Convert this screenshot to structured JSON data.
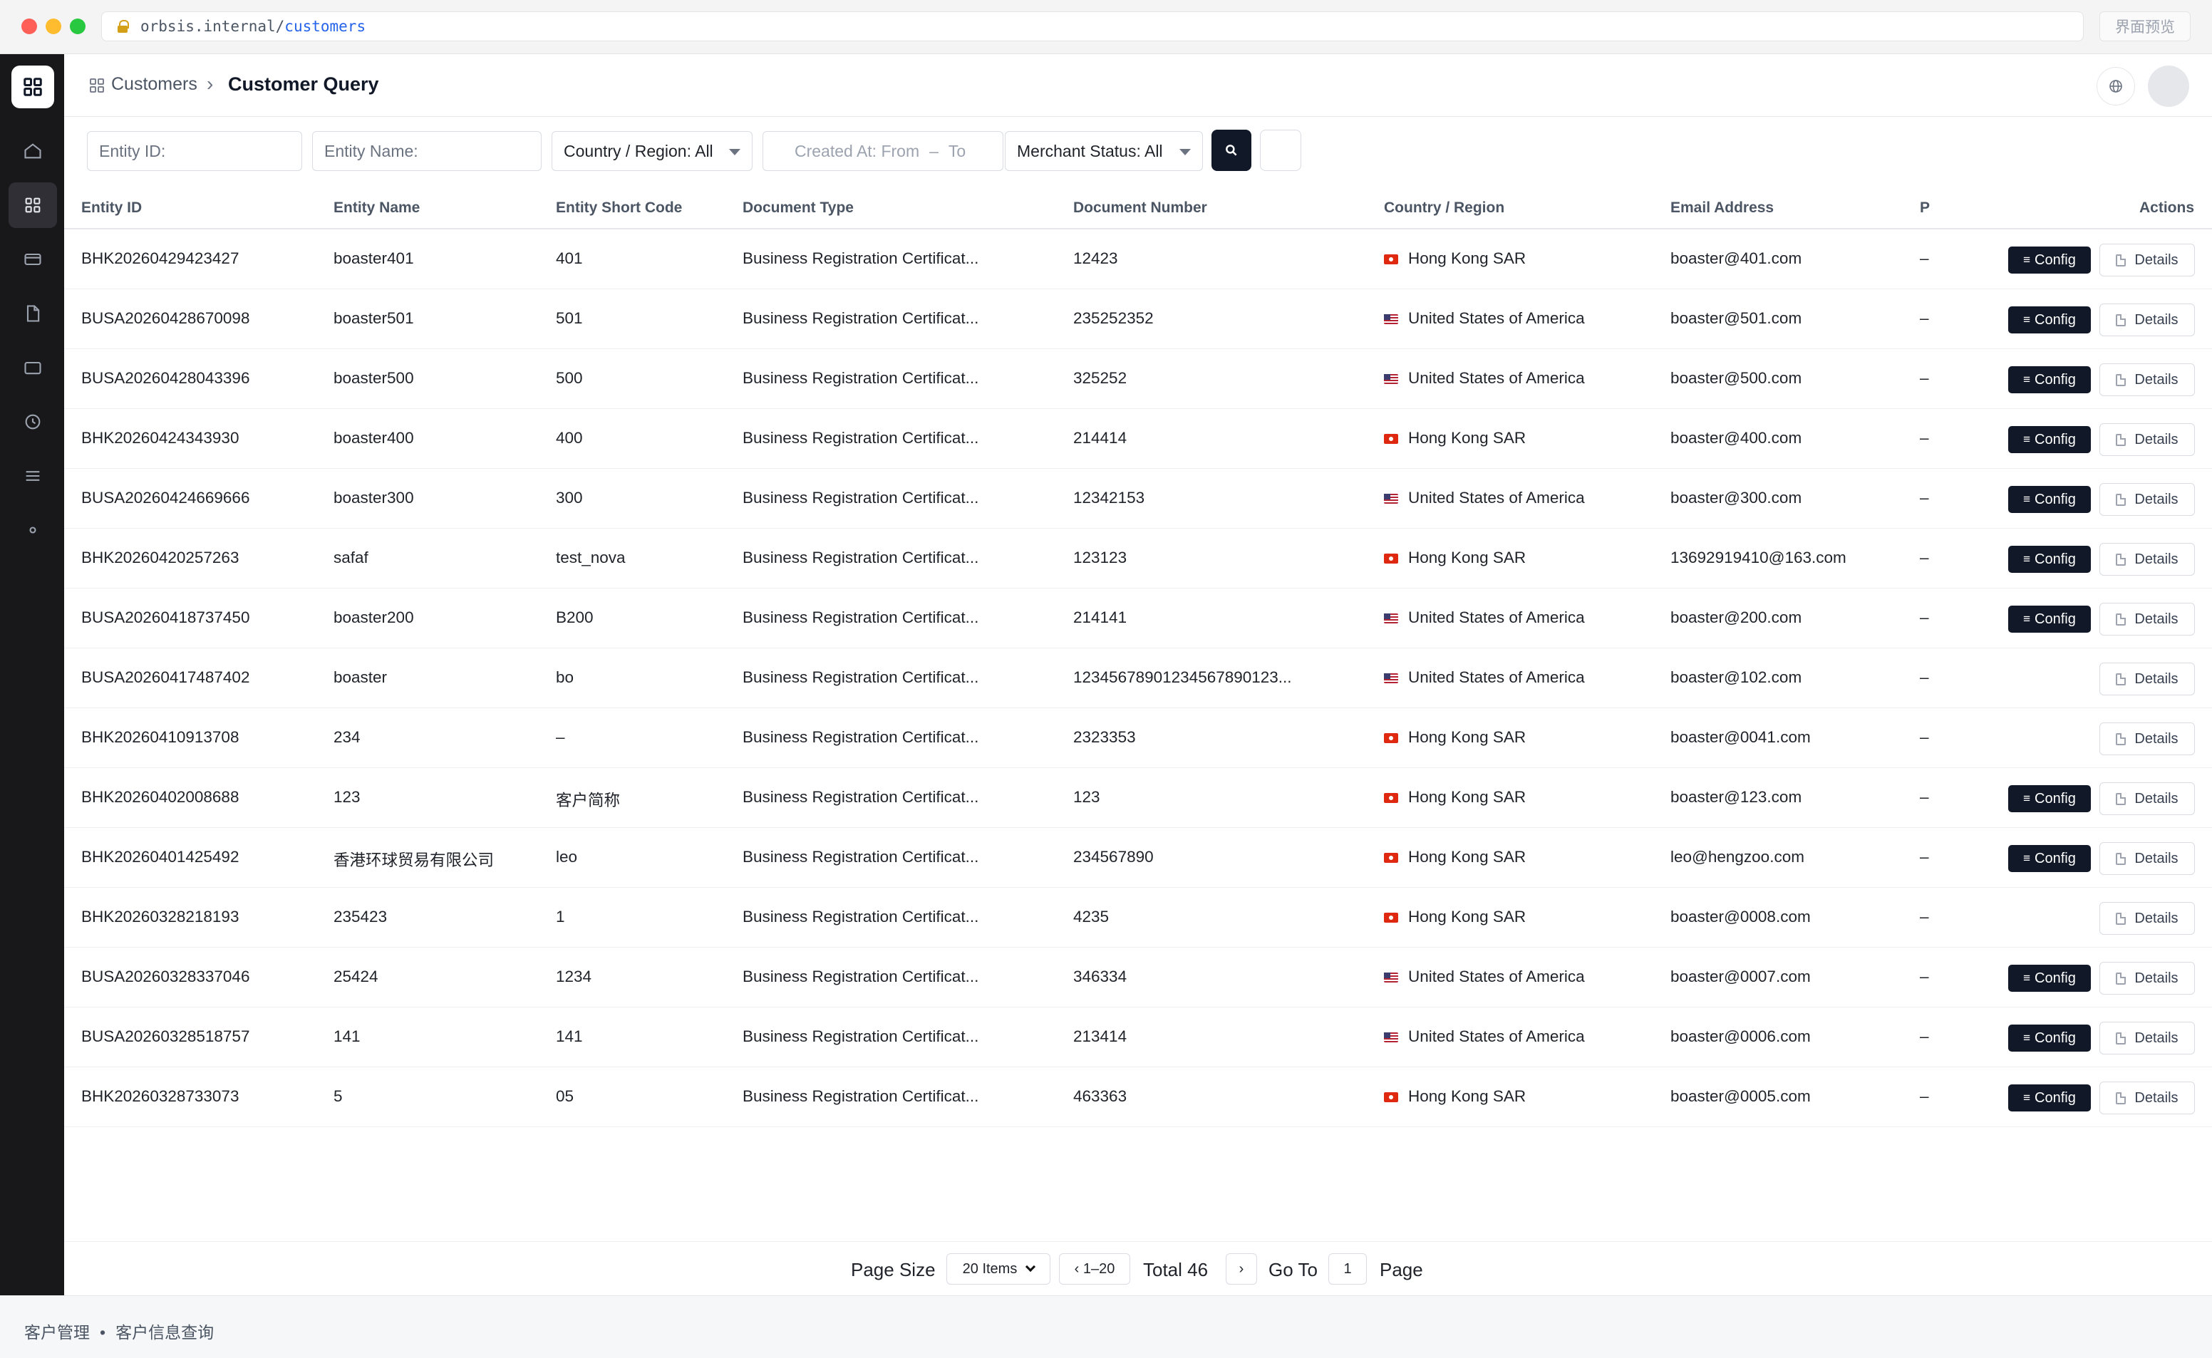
{
  "browser": {
    "url_host": "orbsis.internal/",
    "url_path": "customers",
    "preview_button": "界面预览"
  },
  "sidebar": {
    "items": [
      {
        "icon": "home-icon"
      },
      {
        "icon": "grid-icon",
        "active": true
      },
      {
        "icon": "card-icon"
      },
      {
        "icon": "document-icon"
      },
      {
        "icon": "wallet-icon"
      },
      {
        "icon": "clock-icon"
      },
      {
        "icon": "list-icon"
      },
      {
        "icon": "dot-icon"
      }
    ]
  },
  "header": {
    "breadcrumb_parent": "Customers",
    "breadcrumb_separator": "›",
    "breadcrumb_current": "Customer Query"
  },
  "filters": {
    "entity_id_placeholder": "Entity ID:",
    "entity_name_placeholder": "Entity Name:",
    "country_select": "Country / Region: All",
    "date_from": "Created At: From",
    "date_sep": "–",
    "date_to": "To",
    "merchant_status": "Merchant Status: All"
  },
  "table": {
    "columns": [
      "Entity ID",
      "Entity Name",
      "Entity Short Code",
      "Document Type",
      "Document Number",
      "Country / Region",
      "Email Address",
      "P",
      "Actions"
    ],
    "config_label": "Config",
    "details_label": "Details",
    "rows": [
      {
        "entity_id": "BHK20260429423427",
        "name": "boaster401",
        "short": "401",
        "doc_type": "Business Registration Certificat...",
        "doc_no": "12423",
        "region": "Hong Kong SAR",
        "flag": "hk",
        "email": "boaster@401.com",
        "p": "–",
        "config": true
      },
      {
        "entity_id": "BUSA20260428670098",
        "name": "boaster501",
        "short": "501",
        "doc_type": "Business Registration Certificat...",
        "doc_no": "235252352",
        "region": "United States of America",
        "flag": "us",
        "email": "boaster@501.com",
        "p": "–",
        "config": true
      },
      {
        "entity_id": "BUSA20260428043396",
        "name": "boaster500",
        "short": "500",
        "doc_type": "Business Registration Certificat...",
        "doc_no": "325252",
        "region": "United States of America",
        "flag": "us",
        "email": "boaster@500.com",
        "p": "–",
        "config": true
      },
      {
        "entity_id": "BHK20260424343930",
        "name": "boaster400",
        "short": "400",
        "doc_type": "Business Registration Certificat...",
        "doc_no": "214414",
        "region": "Hong Kong SAR",
        "flag": "hk",
        "email": "boaster@400.com",
        "p": "–",
        "config": true
      },
      {
        "entity_id": "BUSA20260424669666",
        "name": "boaster300",
        "short": "300",
        "doc_type": "Business Registration Certificat...",
        "doc_no": "12342153",
        "region": "United States of America",
        "flag": "us",
        "email": "boaster@300.com",
        "p": "–",
        "config": true
      },
      {
        "entity_id": "BHK20260420257263",
        "name": "safaf",
        "short": "test_nova",
        "doc_type": "Business Registration Certificat...",
        "doc_no": "123123",
        "region": "Hong Kong SAR",
        "flag": "hk",
        "email": "13692919410@163.com",
        "p": "–",
        "config": true
      },
      {
        "entity_id": "BUSA20260418737450",
        "name": "boaster200",
        "short": "B200",
        "doc_type": "Business Registration Certificat...",
        "doc_no": "214141",
        "region": "United States of America",
        "flag": "us",
        "email": "boaster@200.com",
        "p": "–",
        "config": true
      },
      {
        "entity_id": "BUSA20260417487402",
        "name": "boaster",
        "short": "bo",
        "doc_type": "Business Registration Certificat...",
        "doc_no": "12345678901234567890123...",
        "region": "United States of America",
        "flag": "us",
        "email": "boaster@102.com",
        "p": "–",
        "config": false
      },
      {
        "entity_id": "BHK20260410913708",
        "name": "234",
        "short": "–",
        "doc_type": "Business Registration Certificat...",
        "doc_no": "2323353",
        "region": "Hong Kong SAR",
        "flag": "hk",
        "email": "boaster@0041.com",
        "p": "–",
        "config": false
      },
      {
        "entity_id": "BHK20260402008688",
        "name": "123",
        "short": "客户简称",
        "doc_type": "Business Registration Certificat...",
        "doc_no": "123",
        "region": "Hong Kong SAR",
        "flag": "hk",
        "email": "boaster@123.com",
        "p": "–",
        "config": true
      },
      {
        "entity_id": "BHK20260401425492",
        "name": "香港环球贸易有限公司",
        "short": "leo",
        "doc_type": "Business Registration Certificat...",
        "doc_no": "234567890",
        "region": "Hong Kong SAR",
        "flag": "hk",
        "email": "leo@hengzoo.com",
        "p": "–",
        "config": true
      },
      {
        "entity_id": "BHK20260328218193",
        "name": "235423",
        "short": "1",
        "doc_type": "Business Registration Certificat...",
        "doc_no": "4235",
        "region": "Hong Kong SAR",
        "flag": "hk",
        "email": "boaster@0008.com",
        "p": "–",
        "config": false
      },
      {
        "entity_id": "BUSA20260328337046",
        "name": "25424",
        "short": "1234",
        "doc_type": "Business Registration Certificat...",
        "doc_no": "346334",
        "region": "United States of America",
        "flag": "us",
        "email": "boaster@0007.com",
        "p": "–",
        "config": true
      },
      {
        "entity_id": "BUSA20260328518757",
        "name": "141",
        "short": "141",
        "doc_type": "Business Registration Certificat...",
        "doc_no": "213414",
        "region": "United States of America",
        "flag": "us",
        "email": "boaster@0006.com",
        "p": "–",
        "config": true
      },
      {
        "entity_id": "BHK20260328733073",
        "name": "5",
        "short": "05",
        "doc_type": "Business Registration Certificat...",
        "doc_no": "463363",
        "region": "Hong Kong SAR",
        "flag": "hk",
        "email": "boaster@0005.com",
        "p": "–",
        "config": true
      }
    ]
  },
  "pagination": {
    "page_size_label": "Page Size",
    "page_size_value": "20 Items",
    "range": "‹ 1–20",
    "total": "Total 46",
    "next": "›",
    "goto_label": "Go To",
    "goto_value": "1",
    "page_label": "Page"
  },
  "footer": {
    "crumb_1": "客户管理",
    "separator": "•",
    "crumb_2": "客户信息查询"
  },
  "colors": {
    "sidebar_bg": "#18181b",
    "primary_button": "#111827",
    "url_path": "#2563eb"
  }
}
